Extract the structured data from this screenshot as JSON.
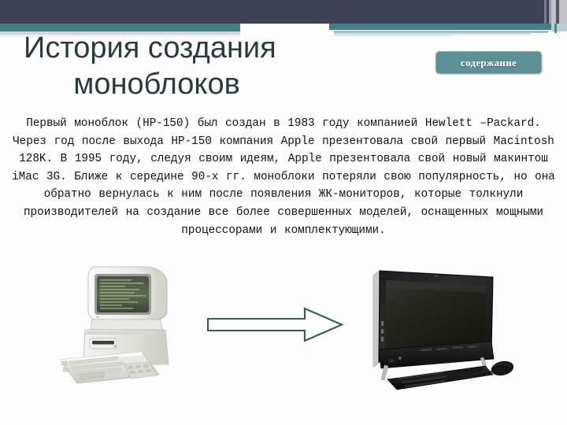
{
  "slide": {
    "title_line1": "История создания",
    "title_line2": "моноблоков",
    "contents_button_label": "содержание",
    "body_text": "Первый моноблок (HP-150) был создан в 1983 году компанией Hewlett\n–Packard. Через год после выхода HP-150 компания Apple\nпрезентовала свой первый Macintosh 128K. В 1995 году, следуя\nсвоим идеям, Apple презентовала свой новый макинтош iMac 3G.\nБлиже к середине 90-х гг. моноблоки потеряли свою популярность,\nно она обратно вернулась к ним после появления ЖК-мониторов,\nкоторые толкнули производителей на создание все более совершенных\nмоделей, оснащенных мощными процессорами и комплектующими."
  },
  "illustration": {
    "old_computer_caption": "HP-150 vintage all-in-one computer with CRT monitor and keyboard",
    "new_computer_caption": "Modern black all-in-one desktop PC with keyboard and mouse",
    "arrow_caption": "evolution arrow pointing right"
  },
  "colors": {
    "header_navy": "#3f4254",
    "header_teal": "#437f85",
    "title_text": "#2b3a3c",
    "button_bg": "#5d8f96",
    "button_text": "#ffffff",
    "body_text": "#121212",
    "arrow_stroke": "#2f5e60",
    "background": "#fdfdfd"
  }
}
